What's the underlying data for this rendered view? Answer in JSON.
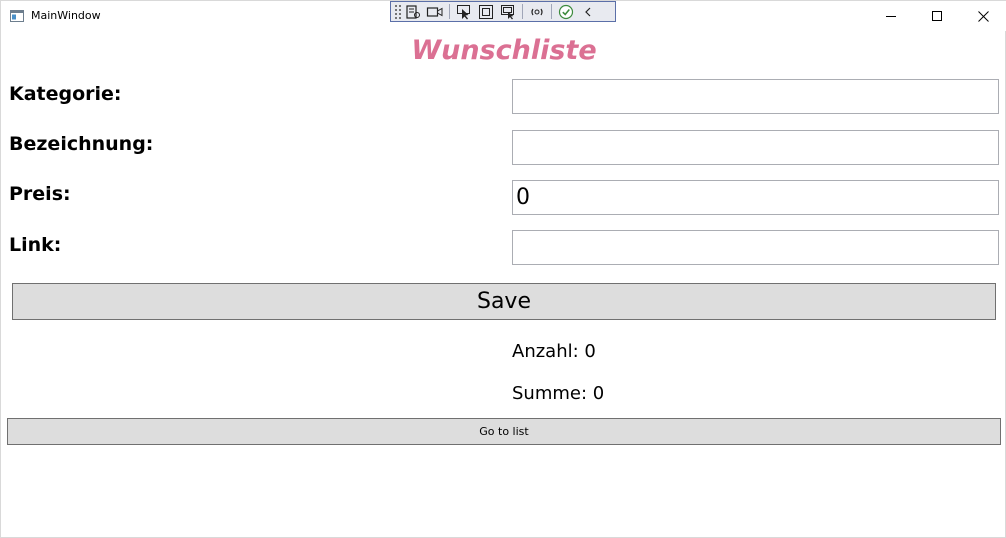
{
  "window": {
    "title": "MainWindow"
  },
  "heading": "Wunschliste",
  "form": {
    "kategorie_label": "Kategorie:",
    "kategorie_value": "",
    "bezeichnung_label": "Bezeichnung:",
    "bezeichnung_value": "",
    "preis_label": "Preis:",
    "preis_value": "0",
    "link_label": "Link:",
    "link_value": ""
  },
  "save_label": "Save",
  "stats": {
    "anzahl": "Anzahl: 0",
    "summe": "Summe: 0"
  },
  "goto_label": "Go to list",
  "colors": {
    "heading": "#db7093",
    "button_bg": "#dddddd",
    "toolbar_border": "#5b6fa8"
  },
  "icons": {
    "window_controls": [
      "minimize-icon",
      "maximize-icon",
      "close-icon"
    ],
    "debug_toolbar": [
      "live-visual-tree-icon",
      "record-icon",
      "select-element-icon",
      "display-layout-adorners-icon",
      "track-focus-icon",
      "hot-reload-icon",
      "binding-check-icon",
      "collapse-icon"
    ]
  }
}
